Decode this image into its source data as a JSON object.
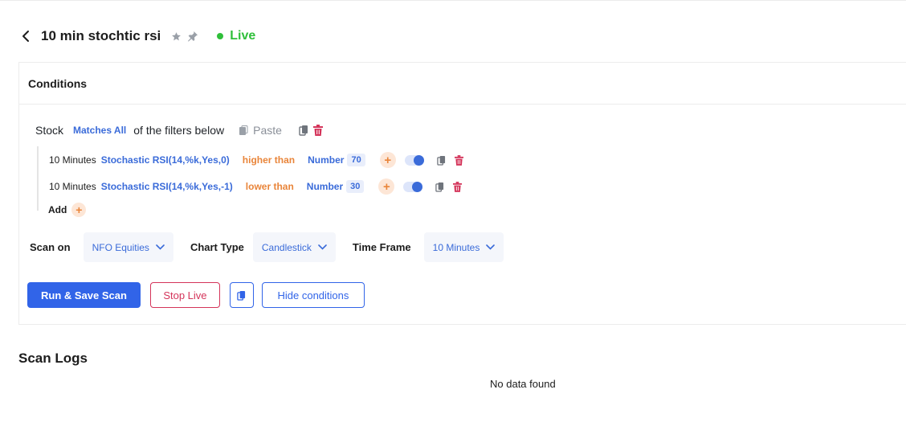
{
  "header": {
    "title": "10 min stochtic rsi",
    "status": "Live",
    "status_color": "#2fbf3a",
    "icons": [
      "chevron-left-icon",
      "star-icon",
      "pin-icon"
    ]
  },
  "conditions": {
    "heading": "Conditions",
    "stock_label": "Stock",
    "match_mode": "Matches All",
    "match_suffix": "of the filters below",
    "paste_label": "Paste",
    "filters": [
      {
        "timeframe": "10 Minutes",
        "indicator": "Stochastic RSI(14,%k,Yes,0)",
        "comparator": "higher than",
        "value_type": "Number",
        "value": "70",
        "enabled": true
      },
      {
        "timeframe": "10 Minutes",
        "indicator": "Stochastic RSI(14,%k,Yes,-1)",
        "comparator": "lower than",
        "value_type": "Number",
        "value": "30",
        "enabled": true
      }
    ],
    "add_label": "Add"
  },
  "scan_settings": {
    "scan_on_label": "Scan on",
    "scan_on_value": "NFO Equities",
    "chart_type_label": "Chart Type",
    "chart_type_value": "Candlestick",
    "time_frame_label": "Time Frame",
    "time_frame_value": "10 Minutes"
  },
  "actions": {
    "run_save": "Run & Save Scan",
    "stop_live": "Stop Live",
    "hide_conditions": "Hide conditions"
  },
  "logs": {
    "title": "Scan Logs",
    "empty_text": "No data found"
  },
  "colors": {
    "accent": "#3164e8",
    "link": "#3a6bd9",
    "comparator": "#e9853a",
    "danger": "#d4345a"
  }
}
